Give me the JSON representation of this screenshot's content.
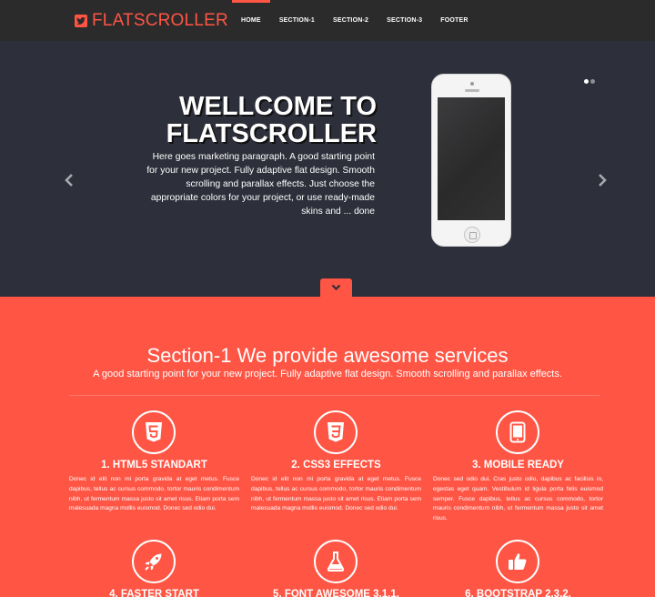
{
  "navbar": {
    "brand": "FLATSCROLLER",
    "brand_icon": "twitter-bird-icon",
    "items": [
      {
        "label": "HOME",
        "active": true
      },
      {
        "label": "SECTION-1",
        "active": false
      },
      {
        "label": "SECTION-2",
        "active": false
      },
      {
        "label": "SECTION-3",
        "active": false
      },
      {
        "label": "FOOTER",
        "active": false
      }
    ]
  },
  "hero": {
    "title_line1": "WELLCOME TO",
    "title_line2": "FLATSCROLLER",
    "paragraph": "Here goes marketing paragraph. A good starting point for your new project. Fully adaptive flat design. Smooth scrolling and parallax effects. Just choose the appropriate colors for your project, or use ready-made skins and ... done",
    "slides": 2,
    "active_slide": 1
  },
  "section1": {
    "title": "Section-1 We provide awesome services",
    "subtitle": "A good starting point for your new project. Fully adaptive flat design. Smooth scrolling and parallax effects.",
    "features": [
      {
        "icon": "html5-icon",
        "title": "1. HTML5 STANDART",
        "text": "Donec id elit non mi porta gravida at eget metus. Fusce dapibus, tellus ac cursus commodo, tortor mauris condimentum nibh, ut fermentum massa justo sit amet risus. Etiam porta sem malesuada magna mollis euismod. Donec sed odio dui."
      },
      {
        "icon": "css3-icon",
        "title": "2. CSS3 EFFECTS",
        "text": "Donec id elit non mi porta gravida at eget metus. Fusce dapibus, tellus ac cursus commodo, tortor mauris condimentum nibh, ut fermentum massa justo sit amet risus. Etiam porta sem malesuada magna mollis euismod. Donec sed odio dui."
      },
      {
        "icon": "tablet-icon",
        "title": "3. MOBILE READY",
        "text": "Donec sed odio dui. Cras justo odio, dapibus ac facilisis in, egestas eget quam. Vestibulum id ligula porta felis euismod semper. Fusce dapibus, tellus ac cursus commodo, tortor mauris condimentum nibh, ut fermentum massa justo sit amet risus."
      },
      {
        "icon": "rocket-icon",
        "title": "4. FASTER START"
      },
      {
        "icon": "flask-icon",
        "title": "5. FONT AWESOME 3.1.1."
      },
      {
        "icon": "thumbs-up-icon",
        "title": "6. BOOTSTRAP 2.3.2."
      }
    ]
  },
  "colors": {
    "accent": "#ff5544",
    "navbar_bg": "#2b2b2b",
    "hero_bg": "#2d2f3a"
  }
}
